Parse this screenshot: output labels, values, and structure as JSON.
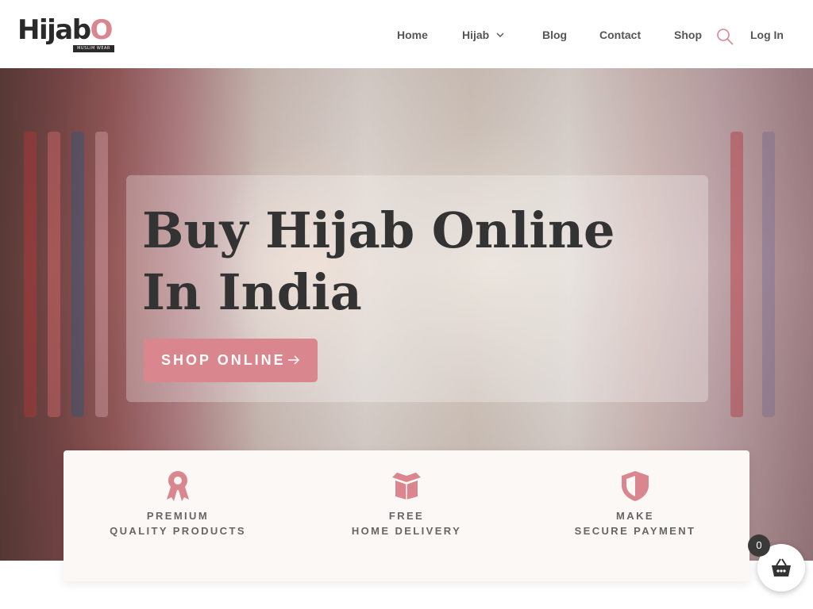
{
  "brand": {
    "logo_text_main": "Hijab",
    "logo_text_o": "O",
    "logo_tagline": "MUSLIM WEAR",
    "accent_color": "#d9868f"
  },
  "nav": {
    "home": "Home",
    "hijab": "Hijab",
    "blog": "Blog",
    "contact": "Contact",
    "shop": "Shop",
    "login": "Log In",
    "hijab_icon": "chevron-down-icon",
    "search_icon": "search-icon"
  },
  "hero": {
    "title_line1": "Buy Hijab Online",
    "title_line2": "In India",
    "button_label": "SHOP ONLINE",
    "button_icon": "arrow-right-icon"
  },
  "features": [
    {
      "icon": "award-ribbon-icon",
      "line1": "PREMIUM",
      "line2": "QUALITY PRODUCTS"
    },
    {
      "icon": "open-box-icon",
      "line1": "FREE",
      "line2": "HOME DELIVERY"
    },
    {
      "icon": "shield-icon",
      "line1": "MAKE",
      "line2": "SECURE PAYMENT"
    }
  ],
  "cart": {
    "count": "0",
    "icon": "basket-icon"
  }
}
